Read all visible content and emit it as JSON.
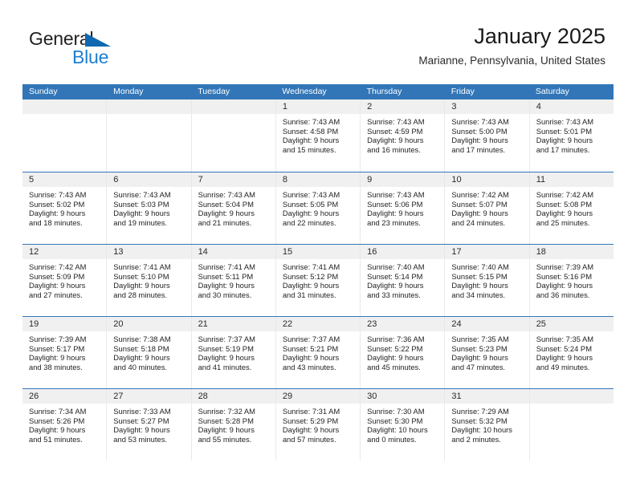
{
  "brand": {
    "name_part1": "General",
    "name_part2": "Blue",
    "triangle_icon": "triangle-icon",
    "accent_dark": "#231f20",
    "accent_blue": "#1c7fd4",
    "triangle_blue": "#1068b0"
  },
  "header": {
    "title": "January 2025",
    "subtitle": "Marianne, Pennsylvania, United States"
  },
  "colors": {
    "header_blue": "#3276b8",
    "date_band": "#f0f0f0",
    "grid_line": "#e9e9e9",
    "text": "#232323"
  },
  "weekdays": [
    "Sunday",
    "Monday",
    "Tuesday",
    "Wednesday",
    "Thursday",
    "Friday",
    "Saturday"
  ],
  "weeks": [
    [
      {
        "day": "",
        "sunrise": "",
        "sunset": "",
        "daylight1": "",
        "daylight2": "",
        "empty": true
      },
      {
        "day": "",
        "sunrise": "",
        "sunset": "",
        "daylight1": "",
        "daylight2": "",
        "empty": true
      },
      {
        "day": "",
        "sunrise": "",
        "sunset": "",
        "daylight1": "",
        "daylight2": "",
        "empty": true
      },
      {
        "day": "1",
        "sunrise": "Sunrise: 7:43 AM",
        "sunset": "Sunset: 4:58 PM",
        "daylight1": "Daylight: 9 hours",
        "daylight2": "and 15 minutes.",
        "empty": false
      },
      {
        "day": "2",
        "sunrise": "Sunrise: 7:43 AM",
        "sunset": "Sunset: 4:59 PM",
        "daylight1": "Daylight: 9 hours",
        "daylight2": "and 16 minutes.",
        "empty": false
      },
      {
        "day": "3",
        "sunrise": "Sunrise: 7:43 AM",
        "sunset": "Sunset: 5:00 PM",
        "daylight1": "Daylight: 9 hours",
        "daylight2": "and 17 minutes.",
        "empty": false
      },
      {
        "day": "4",
        "sunrise": "Sunrise: 7:43 AM",
        "sunset": "Sunset: 5:01 PM",
        "daylight1": "Daylight: 9 hours",
        "daylight2": "and 17 minutes.",
        "empty": false
      }
    ],
    [
      {
        "day": "5",
        "sunrise": "Sunrise: 7:43 AM",
        "sunset": "Sunset: 5:02 PM",
        "daylight1": "Daylight: 9 hours",
        "daylight2": "and 18 minutes.",
        "empty": false
      },
      {
        "day": "6",
        "sunrise": "Sunrise: 7:43 AM",
        "sunset": "Sunset: 5:03 PM",
        "daylight1": "Daylight: 9 hours",
        "daylight2": "and 19 minutes.",
        "empty": false
      },
      {
        "day": "7",
        "sunrise": "Sunrise: 7:43 AM",
        "sunset": "Sunset: 5:04 PM",
        "daylight1": "Daylight: 9 hours",
        "daylight2": "and 21 minutes.",
        "empty": false
      },
      {
        "day": "8",
        "sunrise": "Sunrise: 7:43 AM",
        "sunset": "Sunset: 5:05 PM",
        "daylight1": "Daylight: 9 hours",
        "daylight2": "and 22 minutes.",
        "empty": false
      },
      {
        "day": "9",
        "sunrise": "Sunrise: 7:43 AM",
        "sunset": "Sunset: 5:06 PM",
        "daylight1": "Daylight: 9 hours",
        "daylight2": "and 23 minutes.",
        "empty": false
      },
      {
        "day": "10",
        "sunrise": "Sunrise: 7:42 AM",
        "sunset": "Sunset: 5:07 PM",
        "daylight1": "Daylight: 9 hours",
        "daylight2": "and 24 minutes.",
        "empty": false
      },
      {
        "day": "11",
        "sunrise": "Sunrise: 7:42 AM",
        "sunset": "Sunset: 5:08 PM",
        "daylight1": "Daylight: 9 hours",
        "daylight2": "and 25 minutes.",
        "empty": false
      }
    ],
    [
      {
        "day": "12",
        "sunrise": "Sunrise: 7:42 AM",
        "sunset": "Sunset: 5:09 PM",
        "daylight1": "Daylight: 9 hours",
        "daylight2": "and 27 minutes.",
        "empty": false
      },
      {
        "day": "13",
        "sunrise": "Sunrise: 7:41 AM",
        "sunset": "Sunset: 5:10 PM",
        "daylight1": "Daylight: 9 hours",
        "daylight2": "and 28 minutes.",
        "empty": false
      },
      {
        "day": "14",
        "sunrise": "Sunrise: 7:41 AM",
        "sunset": "Sunset: 5:11 PM",
        "daylight1": "Daylight: 9 hours",
        "daylight2": "and 30 minutes.",
        "empty": false
      },
      {
        "day": "15",
        "sunrise": "Sunrise: 7:41 AM",
        "sunset": "Sunset: 5:12 PM",
        "daylight1": "Daylight: 9 hours",
        "daylight2": "and 31 minutes.",
        "empty": false
      },
      {
        "day": "16",
        "sunrise": "Sunrise: 7:40 AM",
        "sunset": "Sunset: 5:14 PM",
        "daylight1": "Daylight: 9 hours",
        "daylight2": "and 33 minutes.",
        "empty": false
      },
      {
        "day": "17",
        "sunrise": "Sunrise: 7:40 AM",
        "sunset": "Sunset: 5:15 PM",
        "daylight1": "Daylight: 9 hours",
        "daylight2": "and 34 minutes.",
        "empty": false
      },
      {
        "day": "18",
        "sunrise": "Sunrise: 7:39 AM",
        "sunset": "Sunset: 5:16 PM",
        "daylight1": "Daylight: 9 hours",
        "daylight2": "and 36 minutes.",
        "empty": false
      }
    ],
    [
      {
        "day": "19",
        "sunrise": "Sunrise: 7:39 AM",
        "sunset": "Sunset: 5:17 PM",
        "daylight1": "Daylight: 9 hours",
        "daylight2": "and 38 minutes.",
        "empty": false
      },
      {
        "day": "20",
        "sunrise": "Sunrise: 7:38 AM",
        "sunset": "Sunset: 5:18 PM",
        "daylight1": "Daylight: 9 hours",
        "daylight2": "and 40 minutes.",
        "empty": false
      },
      {
        "day": "21",
        "sunrise": "Sunrise: 7:37 AM",
        "sunset": "Sunset: 5:19 PM",
        "daylight1": "Daylight: 9 hours",
        "daylight2": "and 41 minutes.",
        "empty": false
      },
      {
        "day": "22",
        "sunrise": "Sunrise: 7:37 AM",
        "sunset": "Sunset: 5:21 PM",
        "daylight1": "Daylight: 9 hours",
        "daylight2": "and 43 minutes.",
        "empty": false
      },
      {
        "day": "23",
        "sunrise": "Sunrise: 7:36 AM",
        "sunset": "Sunset: 5:22 PM",
        "daylight1": "Daylight: 9 hours",
        "daylight2": "and 45 minutes.",
        "empty": false
      },
      {
        "day": "24",
        "sunrise": "Sunrise: 7:35 AM",
        "sunset": "Sunset: 5:23 PM",
        "daylight1": "Daylight: 9 hours",
        "daylight2": "and 47 minutes.",
        "empty": false
      },
      {
        "day": "25",
        "sunrise": "Sunrise: 7:35 AM",
        "sunset": "Sunset: 5:24 PM",
        "daylight1": "Daylight: 9 hours",
        "daylight2": "and 49 minutes.",
        "empty": false
      }
    ],
    [
      {
        "day": "26",
        "sunrise": "Sunrise: 7:34 AM",
        "sunset": "Sunset: 5:26 PM",
        "daylight1": "Daylight: 9 hours",
        "daylight2": "and 51 minutes.",
        "empty": false
      },
      {
        "day": "27",
        "sunrise": "Sunrise: 7:33 AM",
        "sunset": "Sunset: 5:27 PM",
        "daylight1": "Daylight: 9 hours",
        "daylight2": "and 53 minutes.",
        "empty": false
      },
      {
        "day": "28",
        "sunrise": "Sunrise: 7:32 AM",
        "sunset": "Sunset: 5:28 PM",
        "daylight1": "Daylight: 9 hours",
        "daylight2": "and 55 minutes.",
        "empty": false
      },
      {
        "day": "29",
        "sunrise": "Sunrise: 7:31 AM",
        "sunset": "Sunset: 5:29 PM",
        "daylight1": "Daylight: 9 hours",
        "daylight2": "and 57 minutes.",
        "empty": false
      },
      {
        "day": "30",
        "sunrise": "Sunrise: 7:30 AM",
        "sunset": "Sunset: 5:30 PM",
        "daylight1": "Daylight: 10 hours",
        "daylight2": "and 0 minutes.",
        "empty": false
      },
      {
        "day": "31",
        "sunrise": "Sunrise: 7:29 AM",
        "sunset": "Sunset: 5:32 PM",
        "daylight1": "Daylight: 10 hours",
        "daylight2": "and 2 minutes.",
        "empty": false
      },
      {
        "day": "",
        "sunrise": "",
        "sunset": "",
        "daylight1": "",
        "daylight2": "",
        "empty": true
      }
    ]
  ]
}
